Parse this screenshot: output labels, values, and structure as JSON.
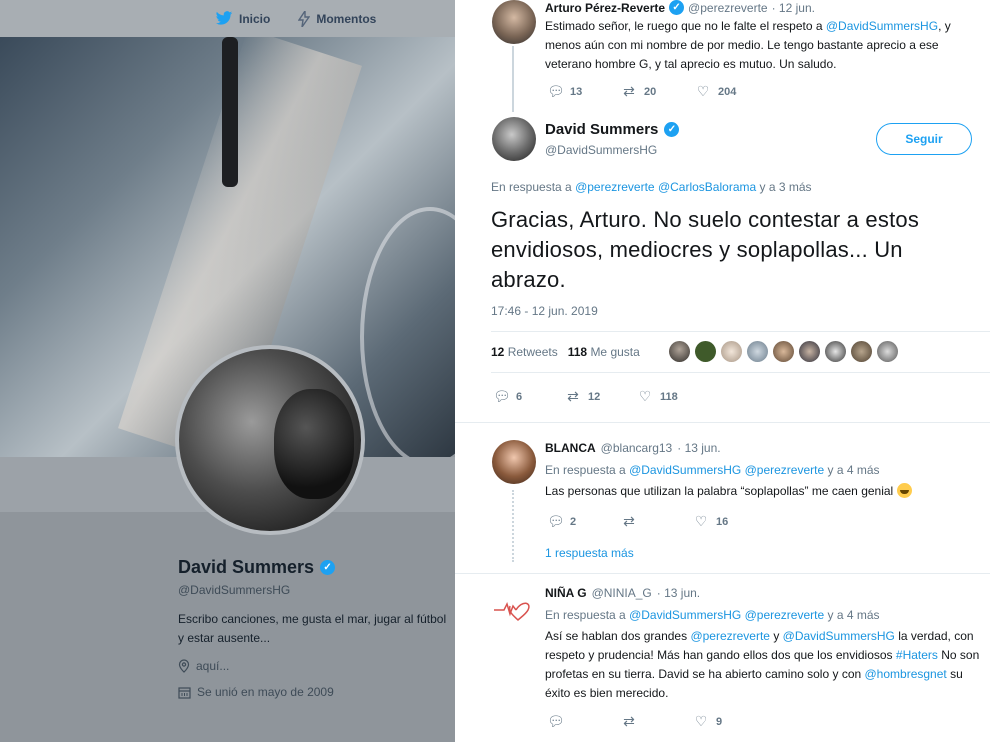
{
  "nav": {
    "home": "Inicio",
    "moments": "Momentos"
  },
  "profile": {
    "name": "David Summers",
    "handle": "@DavidSummersHG",
    "bio": "Escribo canciones, me gusta el mar, jugar al fútbol y estar ausente...",
    "location": "aquí...",
    "joined": "Se unió en mayo de 2009"
  },
  "parent_tweet": {
    "name": "Arturo Pérez-Reverte",
    "handle": "@perezreverte",
    "date": "· 12 jun.",
    "text_parts": [
      "Estimado señor, le ruego que no le falte el respeto a ",
      "@DavidSummersHG",
      ", y menos aún con mi nombre de por medio. Le tengo bastante aprecio a ese veterano hombre G, y tal aprecio es mutuo. Un saludo."
    ],
    "replies": "13",
    "retweets": "20",
    "likes": "204"
  },
  "main_tweet": {
    "name": "David Summers",
    "handle": "@DavidSummersHG",
    "follow_label": "Seguir",
    "reply_prefix": "En respuesta a ",
    "reply_to": "@perezreverte @CarlosBalorama",
    "reply_suffix": " y a 3 más",
    "text": "Gracias, Arturo. No suelo contestar a estos envidiosos, mediocres y soplapollas... Un abrazo.",
    "timestamp": "17:46 - 12 jun. 2019",
    "retweet_count": "12",
    "retweet_label": "Retweets",
    "like_count": "118",
    "like_label": "Me gusta",
    "replies": "6",
    "retweets": "12",
    "likes": "118"
  },
  "reply1": {
    "name": "BLANCA",
    "handle": "@blancarg13",
    "date": "· 13 jun.",
    "reply_prefix": "En respuesta a ",
    "reply_to": "@DavidSummersHG @perezreverte",
    "reply_suffix": " y a 4 más",
    "text": "Las personas que utilizan la palabra “soplapollas” me caen genial",
    "replies": "2",
    "retweets": "",
    "likes": "16",
    "more": "1 respuesta más"
  },
  "reply2": {
    "name": "NIÑA G",
    "handle": "@NINIA_G",
    "date": "· 13 jun.",
    "reply_prefix": "En respuesta a ",
    "reply_to": "@DavidSummersHG @perezreverte",
    "reply_suffix": " y a 4 más",
    "text_parts": [
      "Así se hablan dos grandes ",
      "@perezreverte",
      " y ",
      "@DavidSummersHG",
      " la verdad, con respeto y prudencia! Más han gando ellos dos que los envidiosos ",
      "#Haters",
      " No son profetas en su tierra. David se ha abierto camino solo y con ",
      "@hombresgnet",
      " su éxito es bien merecido."
    ],
    "replies": "",
    "retweets": "",
    "likes": "9"
  }
}
